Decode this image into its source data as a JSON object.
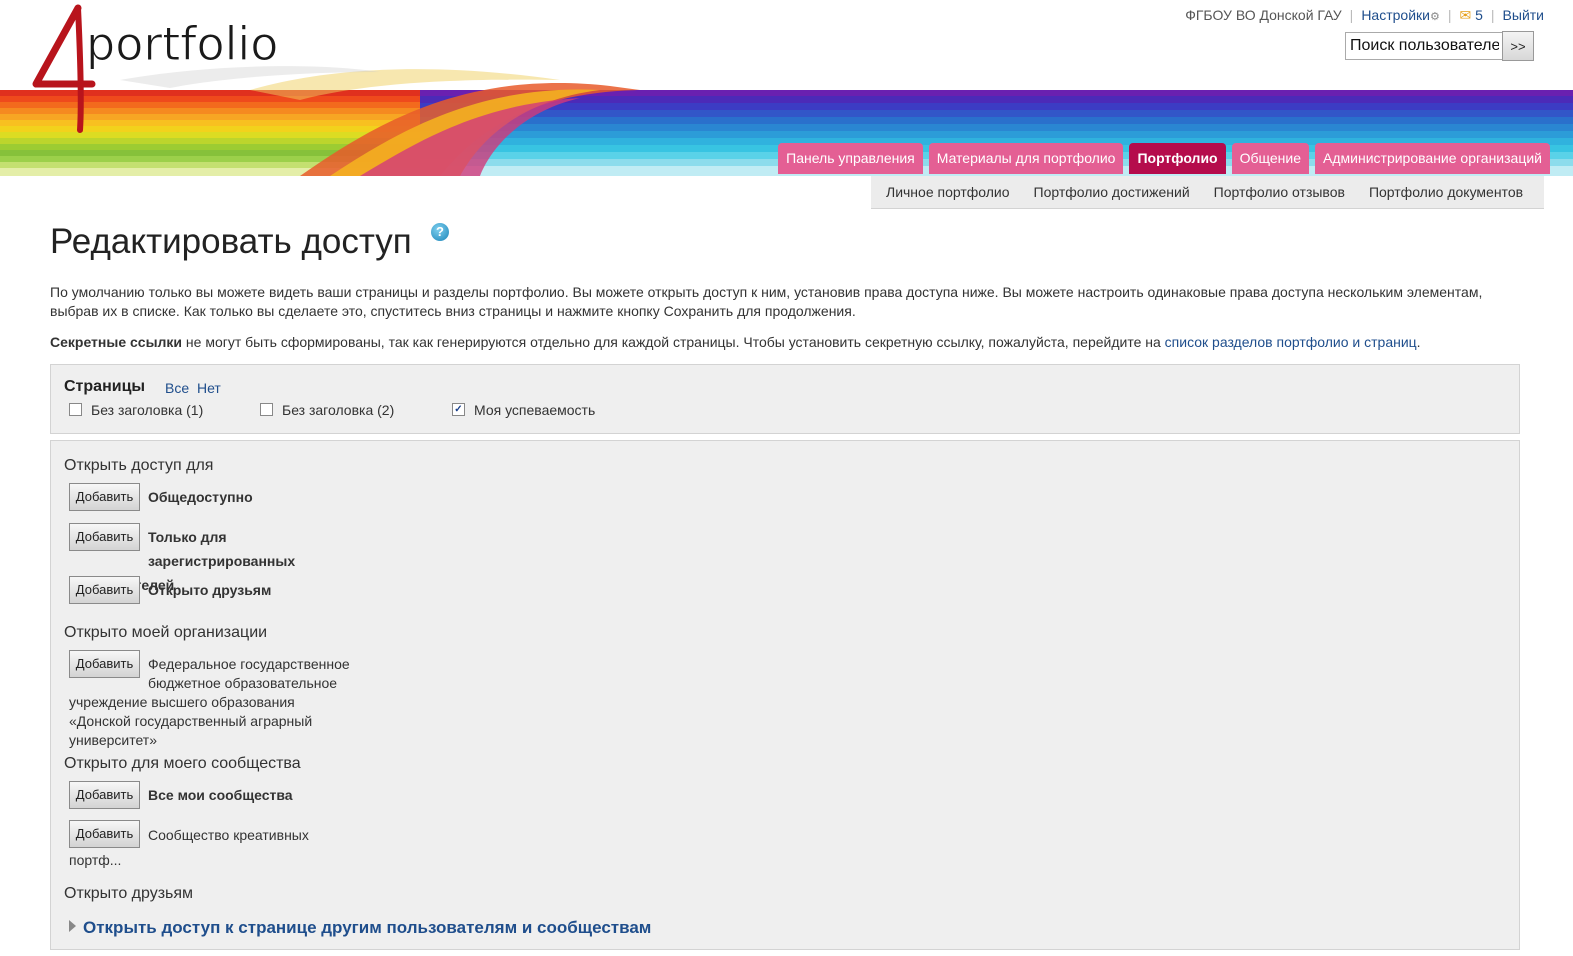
{
  "brand": {
    "logo_text": "4portfolio"
  },
  "top_links": {
    "institution": "ФГБОУ ВО Донской ГАУ",
    "settings": "Настройки",
    "messages_count": "5",
    "logout": "Выйти"
  },
  "search": {
    "value": "Поиск пользователей",
    "button": ">>"
  },
  "main_tabs": [
    "Панель управления",
    "Материалы для портфолио",
    "Портфолио",
    "Общение",
    "Администрирование организаций"
  ],
  "active_tab": "Портфолио",
  "sub_tabs": [
    "Личное портфолио",
    "Портфолио достижений",
    "Портфолио отзывов",
    "Портфолио документов"
  ],
  "page_title": "Редактировать доступ",
  "intro": "По умолчанию только вы можете видеть ваши страницы и разделы портфолио. Вы можете открыть доступ к ним, установив права доступа ниже. Вы можете настроить одинаковые права доступа нескольким элементам, выбрав их в списке. Как только вы сделаете это, спуститесь вниз страницы и нажмите кнопку Сохранить для продолжения.",
  "secret": {
    "bold": "Секретные ссылки",
    "text": " не могут быть сформированы, так как генерируются отдельно для каждой страницы. Чтобы установить секретную ссылку, пожалуйста, перейдите на ",
    "link": "список разделов портфолио и страниц",
    "end": "."
  },
  "pages": {
    "heading": "Страницы",
    "all": "Все",
    "none": "Нет",
    "items": [
      {
        "label": "Без заголовка (1)",
        "checked": false
      },
      {
        "label": "Без заголовка (2)",
        "checked": false
      },
      {
        "label": "Моя успеваемость",
        "checked": true
      }
    ]
  },
  "access": {
    "add_label": "Добавить",
    "sections": {
      "share_for": "Открыть доступ для",
      "my_org": "Открыто моей организации",
      "my_community": "Открыто для моего сообщества",
      "friends": "Открыто друзьям"
    },
    "items": {
      "public": "Общедоступно",
      "registered": "Только для зарегистрированных пользователей",
      "friends": "Открыто друзьям",
      "org": "Федеральное государственное бюджетное образовательное учреждение высшего образования «Донской государственный аграрный университет»",
      "all_communities": "Все мои сообщества",
      "community": "Сообщество креативных портф..."
    },
    "expand": "Открыть доступ к странице другим пользователям и сообществам"
  }
}
